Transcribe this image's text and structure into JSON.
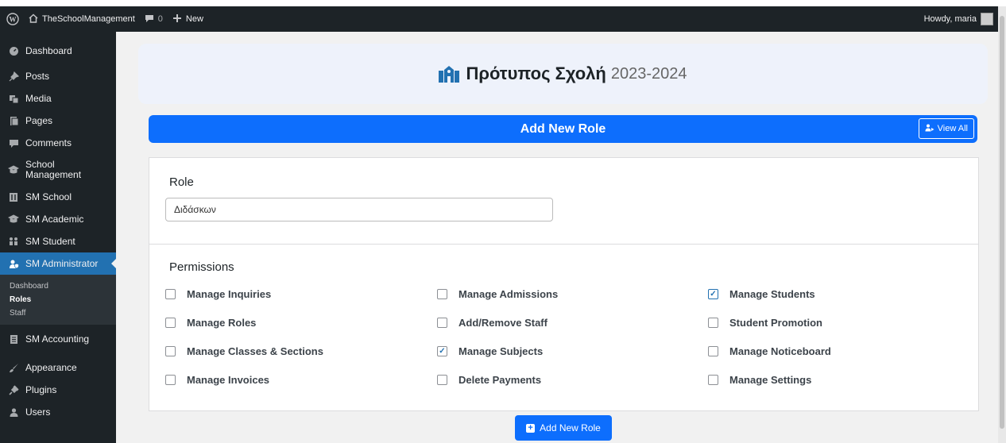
{
  "adminbar": {
    "site_name": "TheSchoolManagement",
    "comments_count": "0",
    "new_label": "New",
    "howdy": "Howdy, maria"
  },
  "sidebar": {
    "items": [
      {
        "label": "Dashboard",
        "icon": "dashboard-icon"
      },
      {
        "label": "Posts",
        "icon": "pin-icon"
      },
      {
        "label": "Media",
        "icon": "media-icon"
      },
      {
        "label": "Pages",
        "icon": "pages-icon"
      },
      {
        "label": "Comments",
        "icon": "comment-icon"
      },
      {
        "label": "School Management",
        "icon": "graduation-cap-icon"
      },
      {
        "label": "SM School",
        "icon": "building-icon"
      },
      {
        "label": "SM Academic",
        "icon": "graduation-cap-icon"
      },
      {
        "label": "SM Student",
        "icon": "students-icon"
      },
      {
        "label": "SM Administrator",
        "icon": "user-shield-icon"
      },
      {
        "label": "SM Accounting",
        "icon": "document-icon"
      },
      {
        "label": "Appearance",
        "icon": "brush-icon"
      },
      {
        "label": "Plugins",
        "icon": "plug-icon"
      },
      {
        "label": "Users",
        "icon": "users-icon"
      }
    ],
    "submenu": [
      "Dashboard",
      "Roles",
      "Staff"
    ]
  },
  "header": {
    "school_name": "Πρότυπος Σχολή",
    "session": "2023-2024"
  },
  "title_bar": {
    "title": "Add New Role",
    "view_all": "View All"
  },
  "role": {
    "label": "Role",
    "value": "Διδάσκων"
  },
  "permissions": {
    "label": "Permissions",
    "items": [
      {
        "label": "Manage Inquiries",
        "checked": false
      },
      {
        "label": "Manage Admissions",
        "checked": false
      },
      {
        "label": "Manage Students",
        "checked": true
      },
      {
        "label": "Manage Roles",
        "checked": false
      },
      {
        "label": "Add/Remove Staff",
        "checked": false
      },
      {
        "label": "Student Promotion",
        "checked": false
      },
      {
        "label": "Manage Classes & Sections",
        "checked": false
      },
      {
        "label": "Manage Subjects",
        "checked": true
      },
      {
        "label": "Manage Noticeboard",
        "checked": false
      },
      {
        "label": "Manage Invoices",
        "checked": false
      },
      {
        "label": "Delete Payments",
        "checked": false
      },
      {
        "label": "Manage Settings",
        "checked": false
      }
    ]
  },
  "submit_label": "Add New Role",
  "colors": {
    "primary": "#0d6efd",
    "wp_dark": "#1d2327",
    "wp_blue": "#2271b1"
  }
}
